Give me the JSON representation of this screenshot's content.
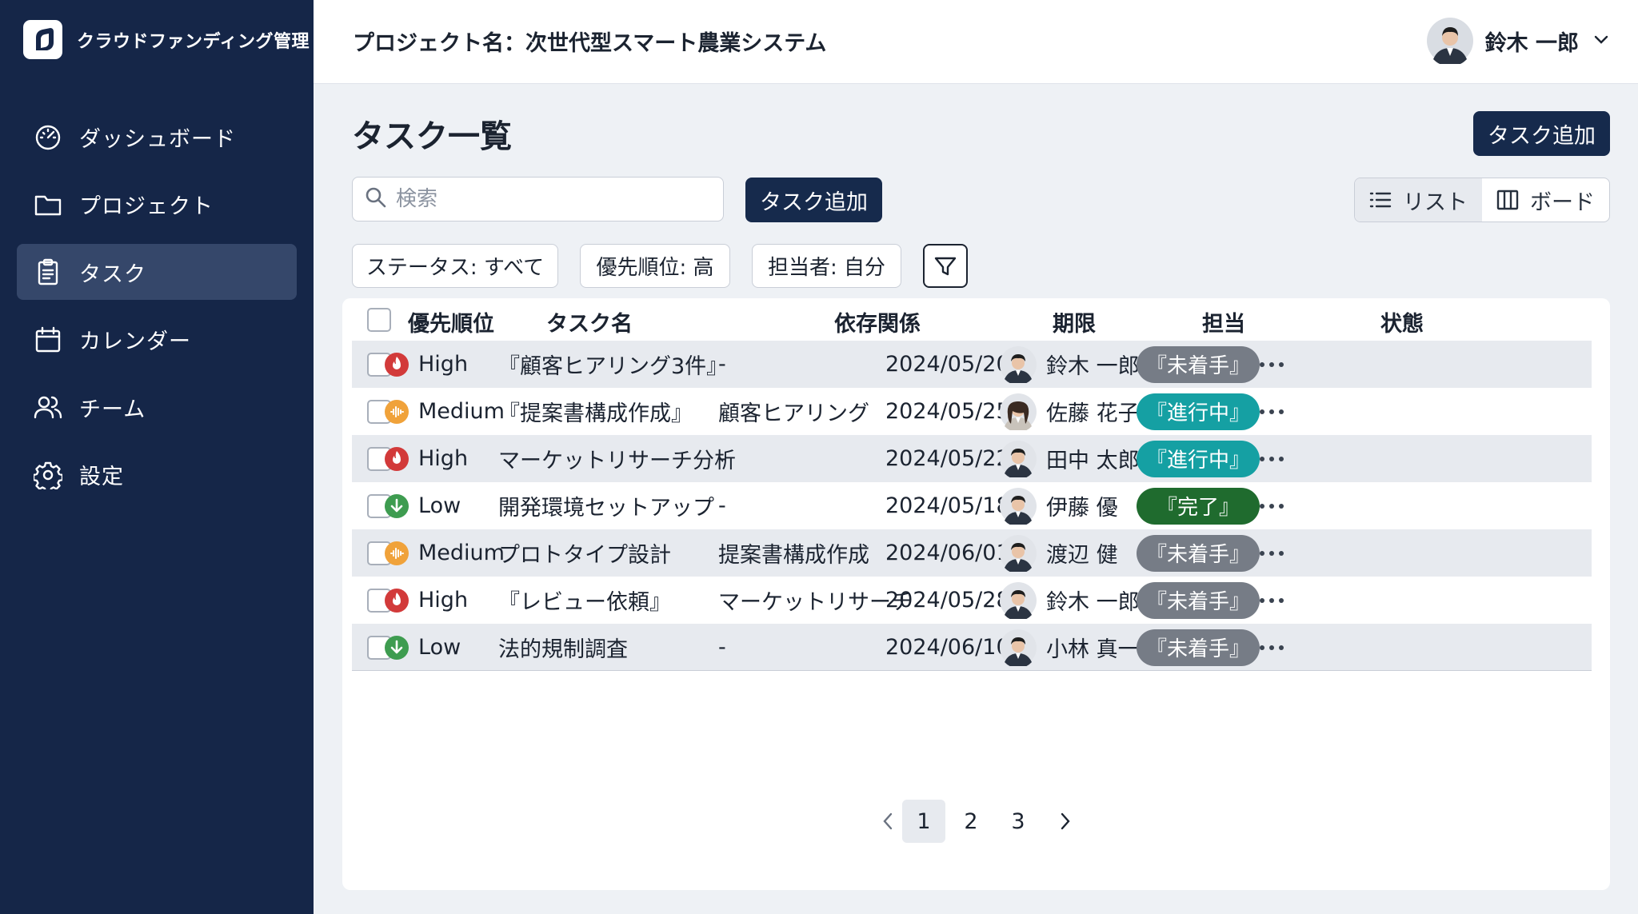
{
  "app": {
    "name": "クラウドファンディング管理"
  },
  "sidebar": {
    "items": [
      {
        "label": "ダッシュボード",
        "icon": "gauge-icon",
        "active": false
      },
      {
        "label": "プロジェクト",
        "icon": "folder-icon",
        "active": false
      },
      {
        "label": "タスク",
        "icon": "clipboard-icon",
        "active": true
      },
      {
        "label": "カレンダー",
        "icon": "calendar-icon",
        "active": false
      },
      {
        "label": "チーム",
        "icon": "users-icon",
        "active": false
      },
      {
        "label": "設定",
        "icon": "gear-icon",
        "active": false
      }
    ]
  },
  "header": {
    "project_title": "プロジェクト名：次世代型スマート農業システム",
    "user_name": "鈴木 一郎"
  },
  "main": {
    "title": "タスク一覧",
    "add_task_label": "タスク追加",
    "search_placeholder": "検索",
    "view_toggle": {
      "list": "リスト",
      "board": "ボード",
      "active": "list"
    },
    "filters": {
      "status": "ステータス: すべて",
      "priority": "優先順位: 高",
      "owner": "担当者: 自分"
    }
  },
  "table": {
    "columns": {
      "priority": "優先順位",
      "name": "タスク名",
      "dependency": "依存関係",
      "due": "期限",
      "owner": "担当",
      "status": "状態"
    },
    "rows": [
      {
        "priority": "High",
        "name": "『顧客ヒアリング3件』",
        "dependency": "-",
        "due": "2024/05/20",
        "owner": "鈴木 一郎",
        "status": "『未着手』"
      },
      {
        "priority": "Medium",
        "name": "『提案書構成作成』",
        "dependency": "顧客ヒアリング",
        "due": "2024/05/25",
        "owner": "佐藤 花子",
        "status": "『進行中』"
      },
      {
        "priority": "High",
        "name": "マーケットリサーチ分析",
        "dependency": "-",
        "due": "2024/05/22",
        "owner": "田中 太郎",
        "status": "『進行中』"
      },
      {
        "priority": "Low",
        "name": "開発環境セットアップ",
        "dependency": "-",
        "due": "2024/05/18",
        "owner": "伊藤 優",
        "status": "『完了』"
      },
      {
        "priority": "Medium",
        "name": "プロトタイプ設計",
        "dependency": "提案書構成作成",
        "due": "2024/06/01",
        "owner": "渡辺 健",
        "status": "『未着手』"
      },
      {
        "priority": "High",
        "name": "『レビュー依頼』",
        "dependency": "マーケットリサーチ",
        "due": "2024/05/28",
        "owner": "鈴木 一郎",
        "status": "『未着手』"
      },
      {
        "priority": "Low",
        "name": "法的規制調査",
        "dependency": "-",
        "due": "2024/06/10",
        "owner": "小林 真一",
        "status": "『未着手』"
      }
    ]
  },
  "pagination": {
    "pages": [
      "1",
      "2",
      "3"
    ],
    "current": "1"
  },
  "colors": {
    "sidebar": "#152648",
    "primary": "#162a4c",
    "high": "#d23a3a",
    "medium": "#f0a23a",
    "low": "#3e9c50",
    "status_todo": "#767c86",
    "status_progress": "#15a0a3",
    "status_done": "#1f6b2e"
  }
}
